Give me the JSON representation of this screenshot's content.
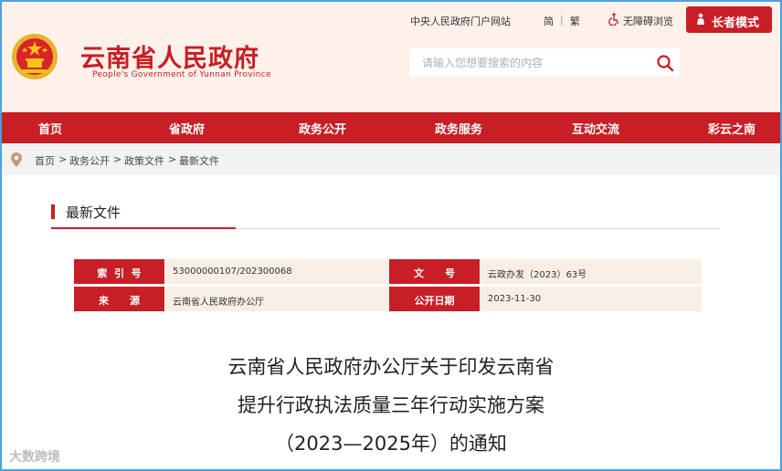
{
  "header": {
    "title": "云南省人民政府",
    "subtitle": "People's Government of Yunnan Province",
    "top_links": {
      "central_portal": "中央人民政府门户网站",
      "simplified": "简",
      "separator": "|",
      "traditional": "繁",
      "accessible": "无障碍浏览",
      "elder_mode": "长者模式"
    },
    "search_placeholder": "请输入您想要搜索的内容"
  },
  "nav": {
    "items": [
      "首页",
      "省政府",
      "政务公开",
      "政务服务",
      "互动交流",
      "彩云之南"
    ]
  },
  "breadcrumb": {
    "items": [
      "首页",
      "政务公开",
      "政策文件",
      "最新文件"
    ],
    "separator": ">"
  },
  "section": {
    "title": "最新文件"
  },
  "meta": {
    "index_label": "索  引  号",
    "index_value": "53000000107/202300068",
    "docno_label": "文      号",
    "docno_value": "云政办发（2023）63号",
    "source_label": "来      源",
    "source_value": "云南省人民政府办公厅",
    "date_label": "公开日期",
    "date_value": "2023-11-30"
  },
  "article": {
    "title_lines": [
      "云南省人民政府办公厅关于印发云南省",
      "提升行政执法质量三年行动实施方案",
      "（2023—2025年）的通知"
    ]
  },
  "watermark": "大数跨境",
  "colors": {
    "brand_red": "#c81e25",
    "header_bg": "#fdf1ea",
    "meta_bg": "#f7efe6"
  }
}
